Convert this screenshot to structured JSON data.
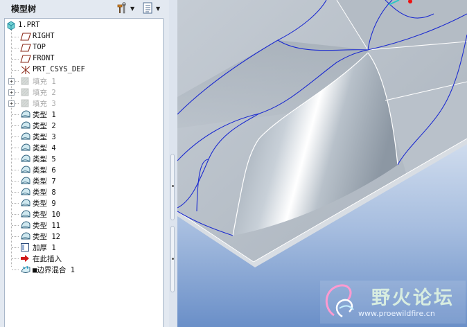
{
  "panel": {
    "title": "模型树",
    "toolbar": [
      {
        "icon": "tools-icon"
      },
      {
        "icon": "tree-settings-icon"
      }
    ]
  },
  "tree": {
    "items": [
      {
        "label": "1.PRT",
        "icon": "part-icon",
        "expand": "",
        "dim": false
      },
      {
        "label": "RIGHT",
        "icon": "datum-plane-icon",
        "expand": "",
        "dim": false
      },
      {
        "label": "TOP",
        "icon": "datum-plane-icon",
        "expand": "",
        "dim": false
      },
      {
        "label": "FRONT",
        "icon": "datum-plane-icon",
        "expand": "",
        "dim": false
      },
      {
        "label": "PRT_CSYS_DEF",
        "icon": "csys-icon",
        "expand": "",
        "dim": false
      },
      {
        "label": "填充 1",
        "icon": "fill-icon",
        "expand": "+",
        "dim": true
      },
      {
        "label": "填充 2",
        "icon": "fill-icon",
        "expand": "+",
        "dim": true
      },
      {
        "label": "填充 3",
        "icon": "fill-icon",
        "expand": "+",
        "dim": true
      },
      {
        "label": "类型 1",
        "icon": "surface-icon",
        "expand": "",
        "dim": false
      },
      {
        "label": "类型 2",
        "icon": "surface-icon",
        "expand": "",
        "dim": false
      },
      {
        "label": "类型 3",
        "icon": "surface-icon",
        "expand": "",
        "dim": false
      },
      {
        "label": "类型 4",
        "icon": "surface-icon",
        "expand": "",
        "dim": false
      },
      {
        "label": "类型 5",
        "icon": "surface-icon",
        "expand": "",
        "dim": false
      },
      {
        "label": "类型 6",
        "icon": "surface-icon",
        "expand": "",
        "dim": false
      },
      {
        "label": "类型 7",
        "icon": "surface-icon",
        "expand": "",
        "dim": false
      },
      {
        "label": "类型 8",
        "icon": "surface-icon",
        "expand": "",
        "dim": false
      },
      {
        "label": "类型 9",
        "icon": "surface-icon",
        "expand": "",
        "dim": false
      },
      {
        "label": "类型 10",
        "icon": "surface-icon",
        "expand": "",
        "dim": false
      },
      {
        "label": "类型 11",
        "icon": "surface-icon",
        "expand": "",
        "dim": false
      },
      {
        "label": "类型 12",
        "icon": "surface-icon",
        "expand": "",
        "dim": false
      },
      {
        "label": "加厚 1",
        "icon": "thicken-icon",
        "expand": "",
        "dim": false
      },
      {
        "label": "在此插入",
        "icon": "insert-here-arrow-icon",
        "expand": "",
        "dim": false
      },
      {
        "label": "■边界混合 1",
        "icon": "boundary-blend-icon",
        "expand": "",
        "dim": false
      }
    ]
  },
  "watermark": {
    "text": "野火论坛",
    "url": "www.proewildfire.cn"
  },
  "colors": {
    "viewport_top": "#ffffff",
    "viewport_bottom": "#5f86c3",
    "edge_blue": "#1c2bd0",
    "panel_bg": "#e3e9f1"
  }
}
